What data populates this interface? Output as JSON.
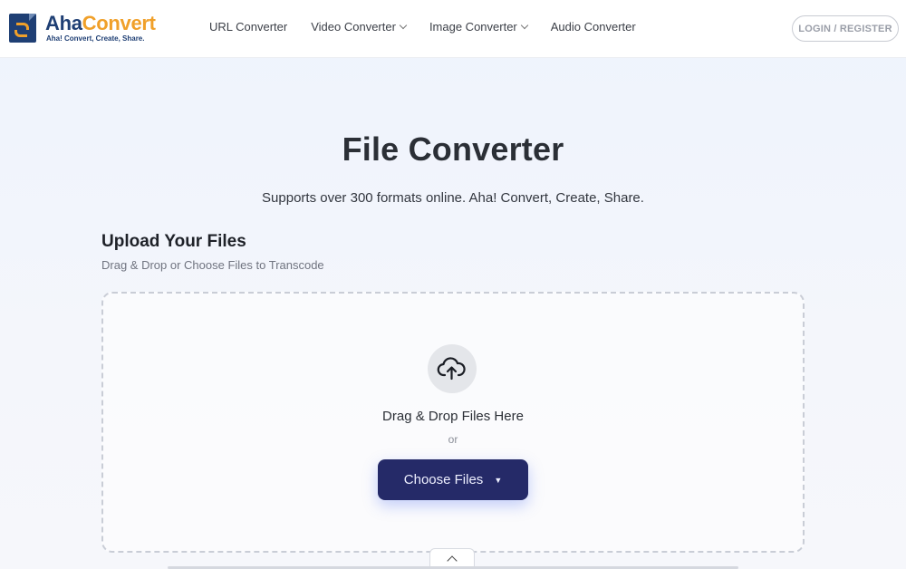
{
  "header": {
    "logo": {
      "name_part1": "Aha",
      "name_part2": "Convert",
      "tagline": "Aha! Convert, Create, Share."
    },
    "nav": [
      {
        "label": "URL Converter",
        "has_dropdown": false
      },
      {
        "label": "Video Converter",
        "has_dropdown": true
      },
      {
        "label": "Image Converter",
        "has_dropdown": true
      },
      {
        "label": "Audio Converter",
        "has_dropdown": false
      }
    ],
    "login_label": "LOGIN / REGISTER"
  },
  "hero": {
    "title": "File Converter",
    "subtitle": "Supports over 300 formats online. Aha! Convert, Create, Share."
  },
  "upload": {
    "title": "Upload Your Files",
    "subtitle": "Drag & Drop or Choose Files to Transcode",
    "drop_text": "Drag & Drop Files Here",
    "or_text": "or",
    "choose_label": "Choose Files",
    "choose_arrow": "▼",
    "icon": "cloud-upload-icon"
  },
  "colors": {
    "brand_navy": "#1f3f74",
    "brand_orange": "#f0a02a",
    "button_bg": "#252a68"
  }
}
